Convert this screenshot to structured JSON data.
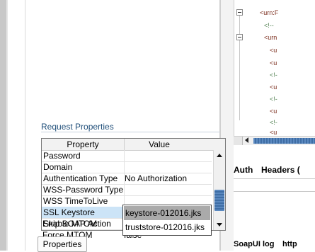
{
  "request_properties": {
    "title": "Request Properties",
    "columns": [
      "Property",
      "Value"
    ],
    "rows": [
      {
        "property": "Password",
        "value": ""
      },
      {
        "property": "Domain",
        "value": ""
      },
      {
        "property": "Authentication Type",
        "value": "No Authorization"
      },
      {
        "property": "WSS-Password Type",
        "value": ""
      },
      {
        "property": "WSS TimeToLive",
        "value": ""
      },
      {
        "property": "SSL Keystore",
        "value": ""
      },
      {
        "property": "Skip SOAP Action",
        "value": ""
      },
      {
        "property": "Enable MTOM",
        "value": ""
      },
      {
        "property": "Force MTOM",
        "value": "false"
      }
    ],
    "dropdown_options": [
      "keystore-012016.jks",
      "truststore-012016.jks"
    ],
    "highlighted_option": "keystore-012016.jks"
  },
  "properties_button": "Properties",
  "xml_lines": [
    "<urn:F",
    "<!--",
    "<urn",
    "<u",
    "<u",
    "<!-",
    "<u",
    "<!-",
    "<u",
    "<!-",
    "<u"
  ],
  "tabs": {
    "auth": "Auth",
    "headers": "Headers ("
  },
  "bottom_tabs": {
    "soapui_log": "SoapUI log",
    "http_log": "http"
  },
  "colors": {
    "accent": "#4f7db3",
    "selection": "#cce4f7",
    "title": "#1f4e79"
  }
}
